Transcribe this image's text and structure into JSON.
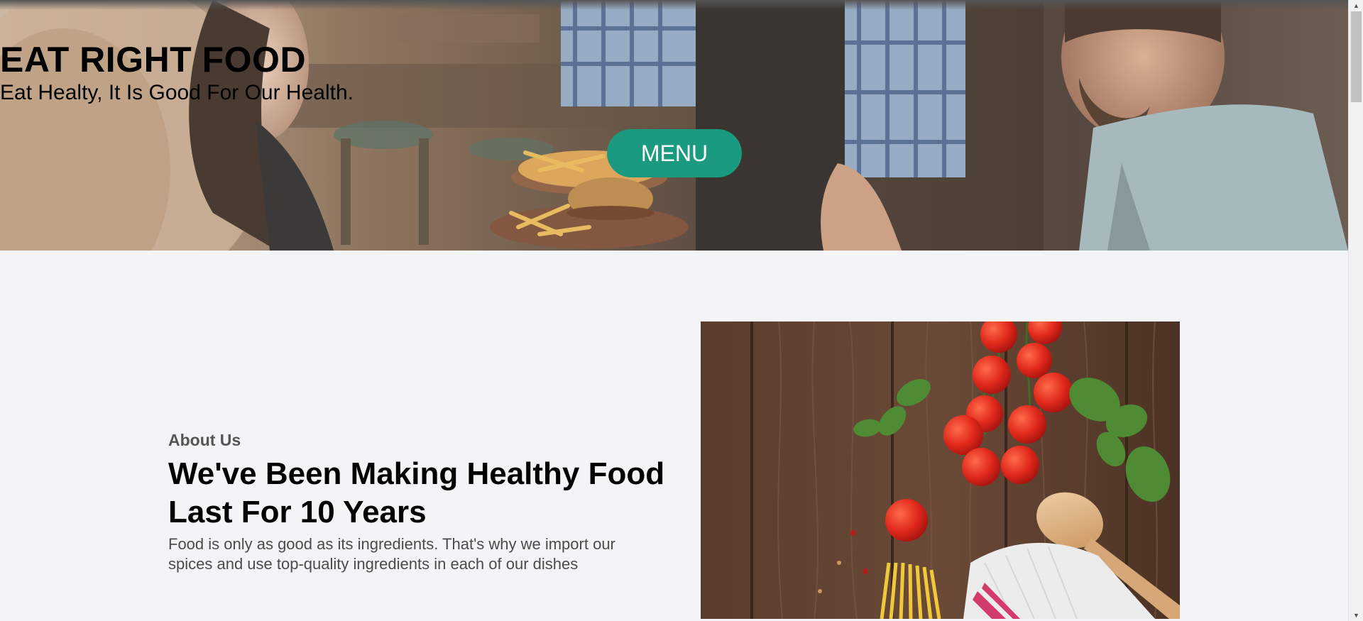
{
  "hero": {
    "title": "EAT RIGHT FOOD",
    "subtitle": "Eat Healty, It Is Good For Our Health.",
    "menu_label": "MENU",
    "button_color": "#1a9a7e"
  },
  "about": {
    "eyebrow": "About Us",
    "heading": "We've Been Making Healthy Food Last For 10 Years",
    "body": "Food is only as good as its ingredients. That's why we import our spices and use top-quality ingredients in each of our dishes"
  },
  "icons": {
    "scroll_up": "▲",
    "scroll_down": "▼"
  }
}
